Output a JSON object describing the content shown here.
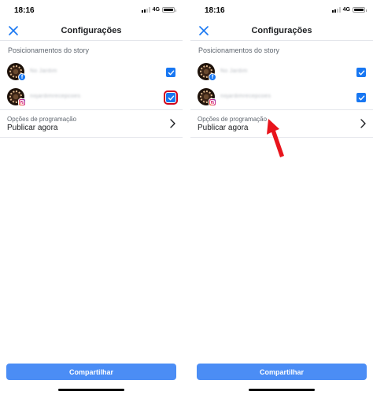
{
  "screens": [
    {
      "status": {
        "time": "18:16",
        "network": "4G"
      },
      "header": {
        "title": "Configurações"
      },
      "placements": {
        "section_title": "Posicionamentos do story",
        "accounts": [
          {
            "platform": "facebook",
            "name": "No Jardim",
            "checked": true,
            "highlighted": false
          },
          {
            "platform": "instagram",
            "name": "nojardimrecepcoes",
            "checked": true,
            "highlighted": true
          }
        ]
      },
      "schedule": {
        "label": "Opções de programação",
        "value": "Publicar agora"
      },
      "share_label": "Compartilhar"
    },
    {
      "status": {
        "time": "18:16",
        "network": "4G"
      },
      "header": {
        "title": "Configurações"
      },
      "placements": {
        "section_title": "Posicionamentos do story",
        "accounts": [
          {
            "platform": "facebook",
            "name": "No Jardim",
            "checked": true,
            "highlighted": false
          },
          {
            "platform": "instagram",
            "name": "nojardimrecepcoes",
            "checked": true,
            "highlighted": false
          }
        ]
      },
      "schedule": {
        "label": "Opções de programação",
        "value": "Publicar agora"
      },
      "share_label": "Compartilhar",
      "annotation": {
        "type": "red-arrow",
        "color": "#e8141c",
        "target": "schedule-options"
      }
    }
  ],
  "colors": {
    "accent": "#1877f2",
    "share_button": "#4b8df5",
    "highlight": "#d0021b",
    "divider": "#e4e6eb",
    "secondary_text": "#606770"
  },
  "icons": {
    "close": "close-icon",
    "chevron": "chevron-right-icon",
    "facebook_badge": "facebook-icon",
    "instagram_badge": "instagram-icon",
    "checkmark": "checkmark-icon"
  }
}
